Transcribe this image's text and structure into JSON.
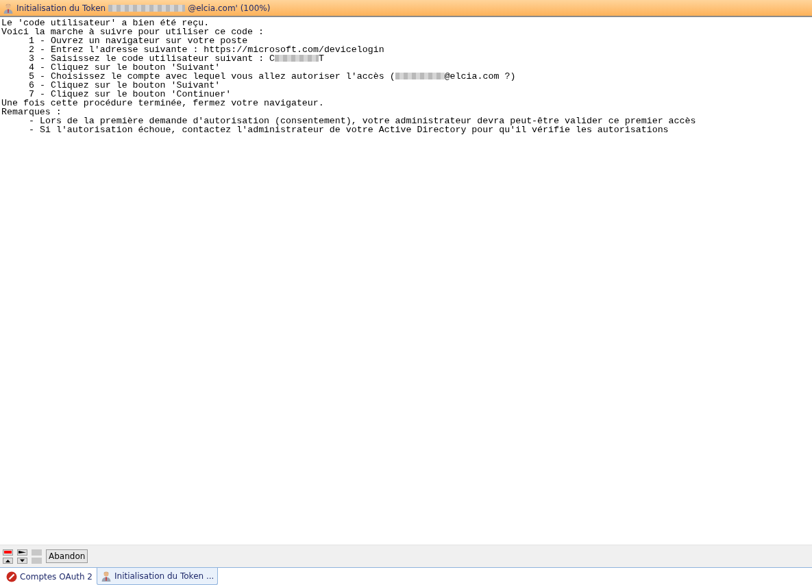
{
  "window": {
    "title": [
      {
        "kind": "text",
        "text": "Initialisation du Token"
      },
      {
        "kind": "redacted"
      },
      {
        "kind": "text",
        "text": "@elcia.com' (100%)"
      }
    ]
  },
  "log": [
    {
      "kind": "plain",
      "parts": [
        {
          "kind": "text",
          "text": "Le 'code utilisateur' a bien été reçu."
        }
      ]
    },
    {
      "kind": "plain",
      "parts": [
        {
          "kind": "text",
          "text": "Voici la marche à suivre pour utiliser ce code :"
        }
      ]
    },
    {
      "kind": "indent",
      "parts": [
        {
          "kind": "text",
          "text": "1 - Ouvrez un navigateur sur votre poste"
        }
      ]
    },
    {
      "kind": "indent",
      "parts": [
        {
          "kind": "text",
          "text": "2 - Entrez l'adresse suivante : https://microsoft.com/devicelogin"
        }
      ]
    },
    {
      "kind": "indent",
      "parts": [
        {
          "kind": "text",
          "text": "3 - Saisissez le code utilisateur suivant : C"
        },
        {
          "kind": "redacted"
        },
        {
          "kind": "text",
          "text": "T"
        }
      ]
    },
    {
      "kind": "indent",
      "parts": [
        {
          "kind": "text",
          "text": "4 - Cliquez sur le bouton 'Suivant'"
        }
      ]
    },
    {
      "kind": "indent",
      "parts": [
        {
          "kind": "text",
          "text": "5 - Choisissez le compte avec lequel vous allez autoriser l'accès ("
        },
        {
          "kind": "redacted"
        },
        {
          "kind": "text",
          "text": "@elcia.com ?)"
        }
      ]
    },
    {
      "kind": "indent",
      "parts": [
        {
          "kind": "text",
          "text": "6 - Cliquez sur le bouton 'Suivant'"
        }
      ]
    },
    {
      "kind": "indent",
      "parts": [
        {
          "kind": "text",
          "text": "7 - Cliquez sur le bouton 'Continuer'"
        }
      ]
    },
    {
      "kind": "plain",
      "parts": [
        {
          "kind": "text",
          "text": "Une fois cette procédure terminée, fermez votre navigateur."
        }
      ]
    },
    {
      "kind": "plain",
      "parts": [
        {
          "kind": "text",
          "text": "Remarques :"
        }
      ]
    },
    {
      "kind": "indent",
      "parts": [
        {
          "kind": "text",
          "text": "- Lors de la première demande d'autorisation (consentement), votre administrateur devra peut-être valider ce premier accès"
        }
      ]
    },
    {
      "kind": "indent",
      "parts": [
        {
          "kind": "text",
          "text": "- Si l'autorisation échoue, contactez l'administrateur de votre Active Directory pour qu'il vérifie les autorisations"
        }
      ]
    }
  ],
  "toolbar": {
    "abort_button": "Abandon"
  },
  "tabs": [
    {
      "label": "Comptes OAuth 2",
      "kind": "error",
      "selected": false
    },
    {
      "label": "Initialisation du Token ...",
      "kind": "user",
      "selected": true
    }
  ]
}
